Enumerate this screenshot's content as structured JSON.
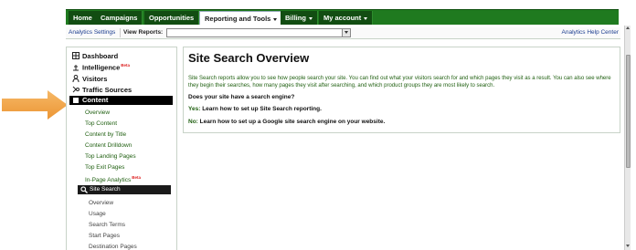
{
  "topnav": {
    "tabs": [
      {
        "label": "Home"
      },
      {
        "label": "Campaigns"
      },
      {
        "label": "Opportunities"
      },
      {
        "label": "Reporting and Tools"
      },
      {
        "label": "Billing"
      },
      {
        "label": "My account"
      }
    ],
    "active_tab": "Reporting and Tools"
  },
  "subbar": {
    "analytics_settings": "Analytics Settings",
    "view_reports_label": "View Reports:",
    "view_reports_value": "",
    "help_center": "Analytics Help Center"
  },
  "sidebar": {
    "dashboard": "Dashboard",
    "intelligence": "Intelligence",
    "beta": "Beta",
    "visitors": "Visitors",
    "traffic_sources": "Traffic Sources",
    "content": "Content",
    "content_items": [
      "Overview",
      "Top Content",
      "Content by Title",
      "Content Drilldown",
      "Top Landing Pages",
      "Top Exit Pages",
      "In-Page Analytics"
    ],
    "site_search": "Site Search",
    "site_search_items": [
      "Overview",
      "Usage",
      "Search Terms",
      "Start Pages",
      "Destination Pages"
    ]
  },
  "main": {
    "title": "Site Search Overview",
    "description": "Site Search reports allow you to see how people search your site. You can find out what your visitors search for and which pages they visit as a result. You can also see where they begin their searches, how many pages they visit after searching, and which product groups they are most likely to search.",
    "question": "Does your site have a search engine?",
    "yes_prefix": "Yes:",
    "yes_link": "Learn how to set up Site Search reporting.",
    "no_prefix": "No:",
    "no_link": "Learn how to set up a Google site search engine on your website."
  },
  "colors": {
    "nav_green": "#1f7a1f",
    "nav_dark": "#124d12",
    "text_green": "#1f5f10",
    "arrow_orange": "#f0a24a"
  }
}
